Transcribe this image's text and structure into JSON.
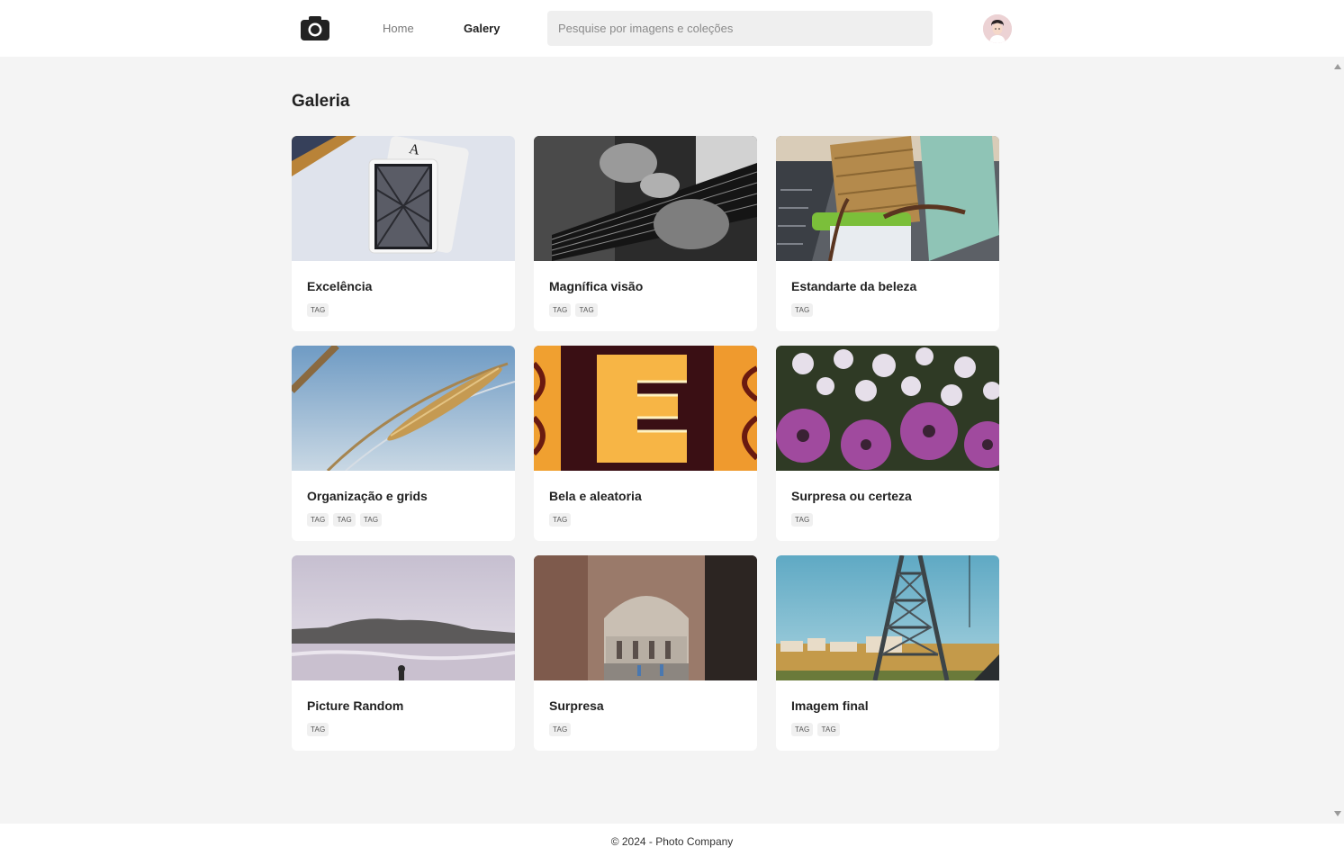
{
  "header": {
    "logo_icon": "camera-icon",
    "nav": [
      {
        "label": "Home",
        "active": false
      },
      {
        "label": "Galery",
        "active": true
      }
    ],
    "search": {
      "placeholder": "Pesquise por imagens e coleções",
      "value": ""
    },
    "avatar_icon": "user-avatar"
  },
  "main": {
    "title": "Galeria",
    "cards": [
      {
        "title": "Excelência",
        "tags": [
          "TAG"
        ],
        "image": "playing-cards-photo"
      },
      {
        "title": "Magnífica visão",
        "tags": [
          "TAG",
          "TAG"
        ],
        "image": "guitar-photo"
      },
      {
        "title": "Estandarte da beleza",
        "tags": [
          "TAG"
        ],
        "image": "wicker-chair-photo"
      },
      {
        "title": "Organização e grids",
        "tags": [
          "TAG",
          "TAG",
          "TAG"
        ],
        "image": "wheat-sky-photo"
      },
      {
        "title": "Bela e aleatoria",
        "tags": [
          "TAG"
        ],
        "image": "neon-letter-photo"
      },
      {
        "title": "Surpresa ou certeza",
        "tags": [
          "TAG"
        ],
        "image": "purple-daisies-photo"
      },
      {
        "title": "Picture Random",
        "tags": [
          "TAG"
        ],
        "image": "misty-beach-photo"
      },
      {
        "title": "Surpresa",
        "tags": [
          "TAG"
        ],
        "image": "ancient-arch-photo"
      },
      {
        "title": "Imagem final",
        "tags": [
          "TAG",
          "TAG"
        ],
        "image": "steel-bridge-photo"
      }
    ]
  },
  "footer": {
    "text": "© 2024 - Photo Company"
  },
  "colors": {
    "background": "#f4f4f4",
    "card": "#ffffff",
    "text": "#222222",
    "muted": "#7a7a7a"
  }
}
